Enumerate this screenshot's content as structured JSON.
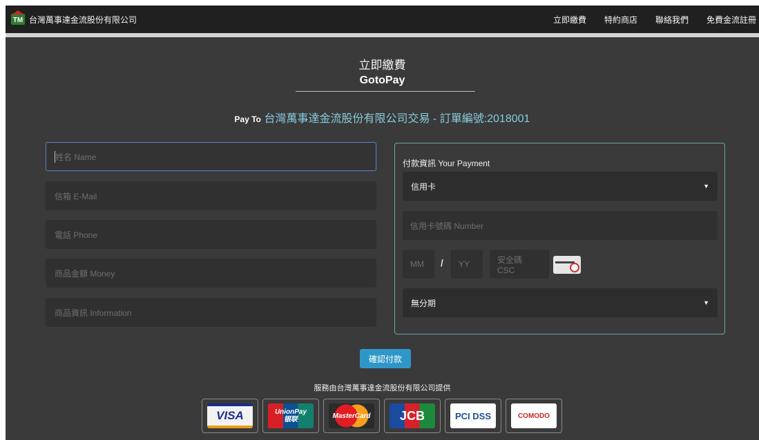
{
  "navbar": {
    "brand_logo_text": "TM",
    "brand_name": "台灣萬事達金流股份有限公司",
    "links": [
      "立即繳費",
      "特約商店",
      "聯絡我們",
      "免費金流註冊"
    ]
  },
  "header": {
    "title_cn": "立即繳費",
    "title_en": "GotoPay"
  },
  "payto": {
    "lead": "Pay To",
    "text": "台灣萬事達金流股份有限公司交易 - 訂單編號:2018001"
  },
  "form": {
    "name_placeholder": "姓名 Name",
    "email_placeholder": "信箱 E-Mail",
    "phone_placeholder": "電話 Phone",
    "money_placeholder": "商品金額 Money",
    "info_placeholder": "商品資訊 Information"
  },
  "payment": {
    "title": "付款資訊 Your Payment",
    "method_selected": "信用卡",
    "card_number_placeholder": "信用卡號碼 Number",
    "month_placeholder": "MM",
    "slash": "/",
    "year_placeholder": "YY",
    "csc_placeholder": "安全碼 CSC",
    "installment_selected": "無分期",
    "caret": "▼"
  },
  "actions": {
    "confirm_label": "確認付款"
  },
  "footer": {
    "service_text": "服務由台灣萬事達金流股份有限公司提供",
    "logos": {
      "visa": "VISA",
      "unionpay_top": "UnionPay",
      "unionpay_bottom": "银联",
      "mastercard": "MasterCard",
      "jcb": "JCB",
      "pci": "PCI DSS",
      "comodo": "COMODO"
    }
  },
  "colors": {
    "accent": "#2f97c8",
    "panel_border": "#67a7a6",
    "payto_text": "#87cbdc",
    "background": "#3a3a3a",
    "navbar": "#202020"
  }
}
